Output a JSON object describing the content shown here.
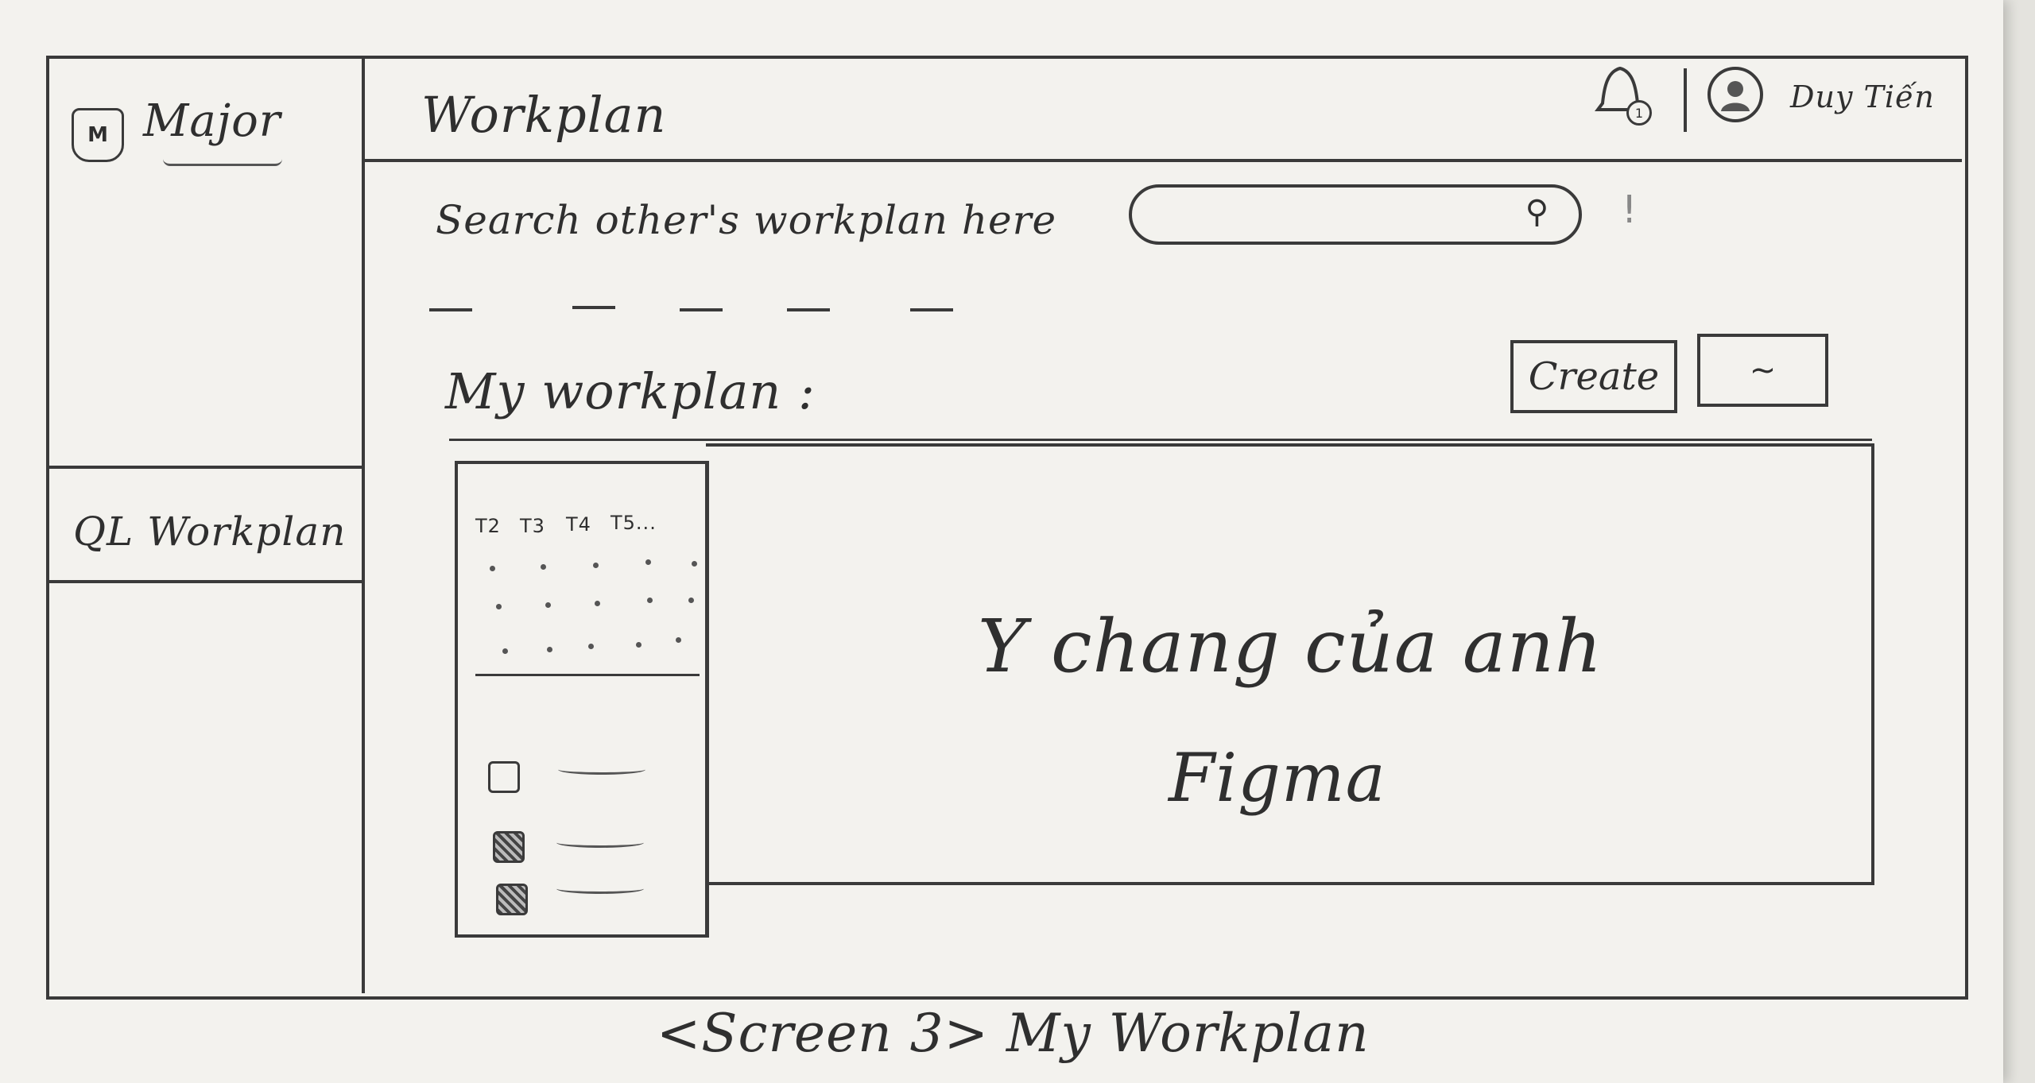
{
  "app": {
    "logo_mark": "M",
    "logo_name": "Major",
    "page_title": "Workplan",
    "notification_count": "1",
    "user_name": "Duy Tiến"
  },
  "sidebar": {
    "items": [
      {
        "label": "QL Workplan"
      }
    ]
  },
  "search": {
    "label": "Search other's workplan here",
    "placeholder": "",
    "icon": "search-icon"
  },
  "section": {
    "title": "My workplan :",
    "create_button": "Create",
    "extra_button": "~"
  },
  "calendar": {
    "days": [
      "T2",
      "T3",
      "T4",
      "T5..."
    ]
  },
  "task_list": {
    "items": [
      {
        "checked": false,
        "label": "~"
      },
      {
        "checked": true,
        "label": "~"
      },
      {
        "checked": true,
        "label": "~"
      }
    ]
  },
  "placeholder_note": {
    "line1": "Y chang của anh",
    "line2": "Figma"
  },
  "caption": "<Screen 3> My Workplan"
}
